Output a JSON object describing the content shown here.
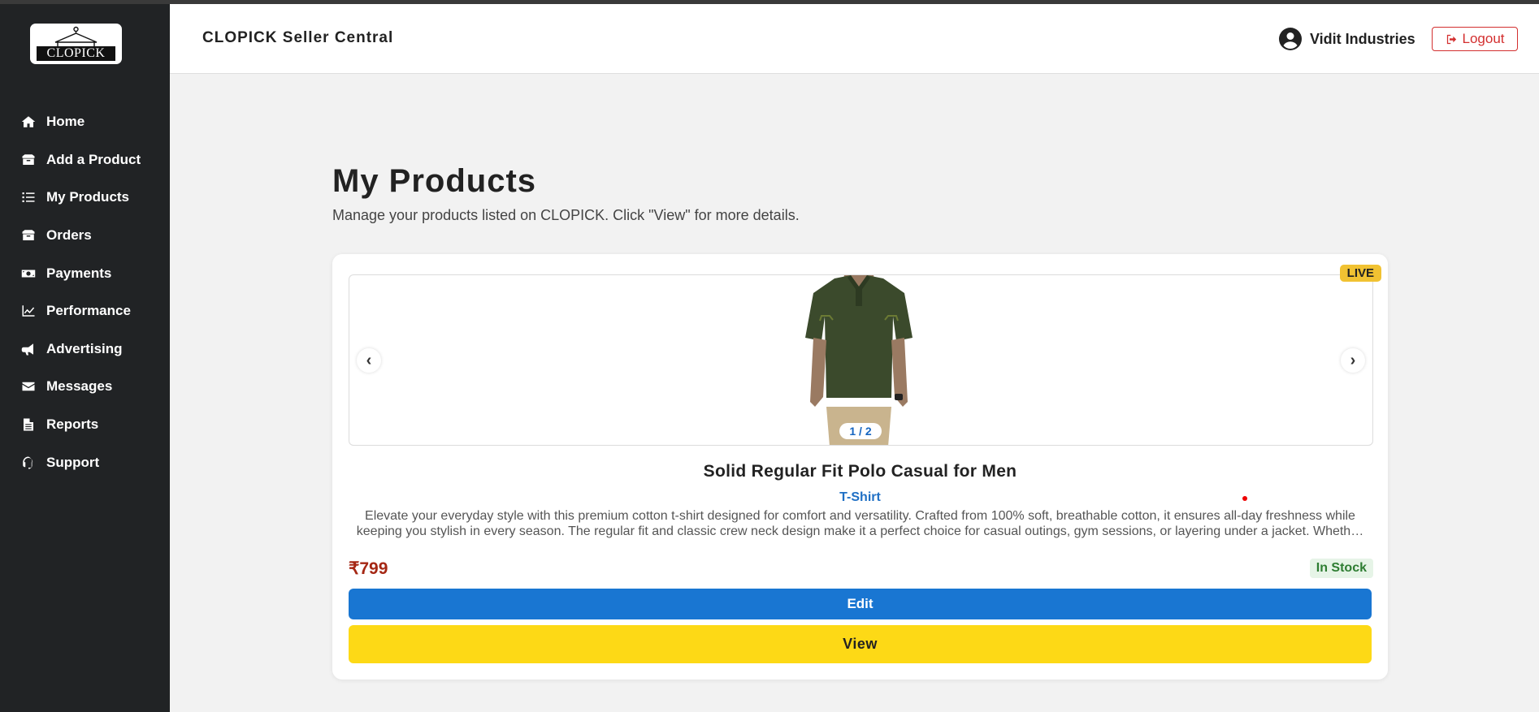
{
  "sidebar": {
    "logo_text": "CLOPICK",
    "items": [
      {
        "label": "Home",
        "icon": "home-icon"
      },
      {
        "label": "Add a Product",
        "icon": "box-icon"
      },
      {
        "label": "My Products",
        "icon": "list-icon"
      },
      {
        "label": "Orders",
        "icon": "box-icon"
      },
      {
        "label": "Payments",
        "icon": "money-icon"
      },
      {
        "label": "Performance",
        "icon": "chart-line-icon"
      },
      {
        "label": "Advertising",
        "icon": "megaphone-icon"
      },
      {
        "label": "Messages",
        "icon": "envelope-icon"
      },
      {
        "label": "Reports",
        "icon": "document-icon"
      },
      {
        "label": "Support",
        "icon": "headset-icon"
      }
    ]
  },
  "header": {
    "brand": "CLOPICK Seller Central",
    "user_name": "Vidit Industries",
    "logout_label": "Logout"
  },
  "main": {
    "title": "My Products",
    "subtitle": "Manage your products listed on CLOPICK. Click \"View\" for more details."
  },
  "product": {
    "status_badge": "LIVE",
    "carousel_counter": "1 / 2",
    "carousel_prev": "‹",
    "carousel_next": "›",
    "title": "Solid Regular Fit Polo Casual for Men",
    "category": "T-Shirt",
    "description": "Elevate your everyday style with this premium cotton t-shirt designed for comfort and versatility. Crafted from 100% soft, breathable cotton, it ensures all-day freshness while keeping you stylish in every season. The regular fit and classic crew neck design make it a perfect choice for casual outings, gym sessions, or layering under a jacket. Wheth…",
    "price": "₹799",
    "stock": "In Stock",
    "edit_label": "Edit",
    "view_label": "View"
  },
  "colors": {
    "sidebar_bg": "#212325",
    "accent_blue": "#1976d2",
    "accent_yellow": "#fdd916",
    "live_badge": "#f1c232",
    "price_red": "#a52714",
    "stock_green": "#2e7d32",
    "logout_red": "#d32f2f"
  }
}
